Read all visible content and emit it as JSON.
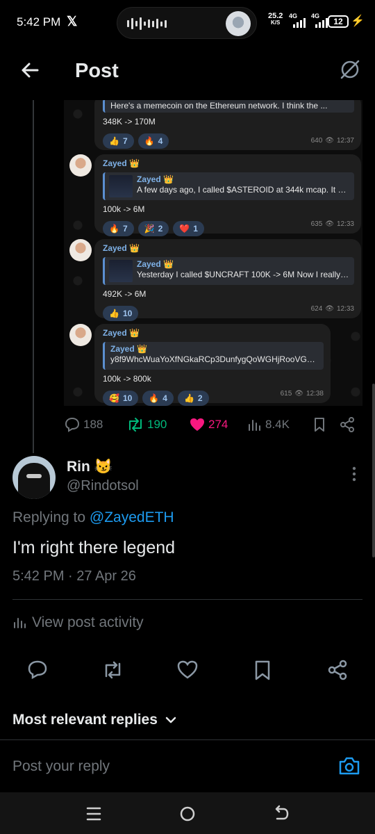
{
  "status_bar": {
    "time": "5:42 PM",
    "app_icon": "x-logo-icon",
    "speed": "25.2",
    "speed_unit": "K/S",
    "network_1": "4G",
    "network_2": "4G",
    "battery": "12"
  },
  "header": {
    "title": "Post",
    "back_icon": "back-arrow-icon",
    "grok_icon": "grok-icon"
  },
  "embedded_chat": {
    "messages": [
      {
        "quote_text": "Here's a memecoin on the Ethereum network. I think the ...",
        "body": "348K -> 170M",
        "reactions": [
          {
            "emoji": "👍",
            "count": "7"
          },
          {
            "emoji": "🔥",
            "count": "4"
          }
        ],
        "views": "640",
        "time": "12:37"
      },
      {
        "sender": "Zayed 👑",
        "quote_name": "Zayed 👑",
        "quote_text": "A few days ago, I called $ASTEROID at 344k mcap. It did ...",
        "body": "100k -> 6M",
        "reactions": [
          {
            "emoji": "🔥",
            "count": "7"
          },
          {
            "emoji": "🎉",
            "count": "2"
          },
          {
            "emoji": "❤️",
            "count": "1"
          }
        ],
        "views": "635",
        "time": "12:33"
      },
      {
        "sender": "Zayed 👑",
        "quote_name": "Zayed 👑",
        "quote_text": "Yesterday I called $UNCRAFT 100K -> 6M Now I really like...",
        "body": "492K -> 6M",
        "reactions": [
          {
            "emoji": "👍",
            "count": "10"
          }
        ],
        "views": "624",
        "time": "12:33"
      },
      {
        "sender": "Zayed 👑",
        "quote_name": "Zayed 👑",
        "quote_text": "y8f9WhcWuaYoXfNGkaRCp3DunfygQoWGHjRooVGpump",
        "body": "100k -> 800k",
        "reactions": [
          {
            "emoji": "🥰",
            "count": "10"
          },
          {
            "emoji": "🔥",
            "count": "4"
          },
          {
            "emoji": "👍",
            "count": "2"
          }
        ],
        "views": "615",
        "time": "12:38"
      }
    ]
  },
  "engagement": {
    "replies": "188",
    "reposts": "190",
    "likes": "274",
    "views": "8.4K"
  },
  "post": {
    "author_name": "Rin 😼",
    "author_handle": "@Rindotsol",
    "replying_prefix": "Replying to ",
    "replying_mention": "@ZayedETH",
    "text": "I'm right there legend",
    "timestamp": "5:42 PM · 27 Apr 26",
    "activity_label": "View post activity"
  },
  "replies_section": {
    "sort_label": "Most relevant replies",
    "reply_placeholder": "Post your reply"
  },
  "colors": {
    "background": "#000000",
    "accent": "#1d9bf0",
    "repost": "#00ba7c",
    "like": "#f91880",
    "muted": "#71767b"
  }
}
